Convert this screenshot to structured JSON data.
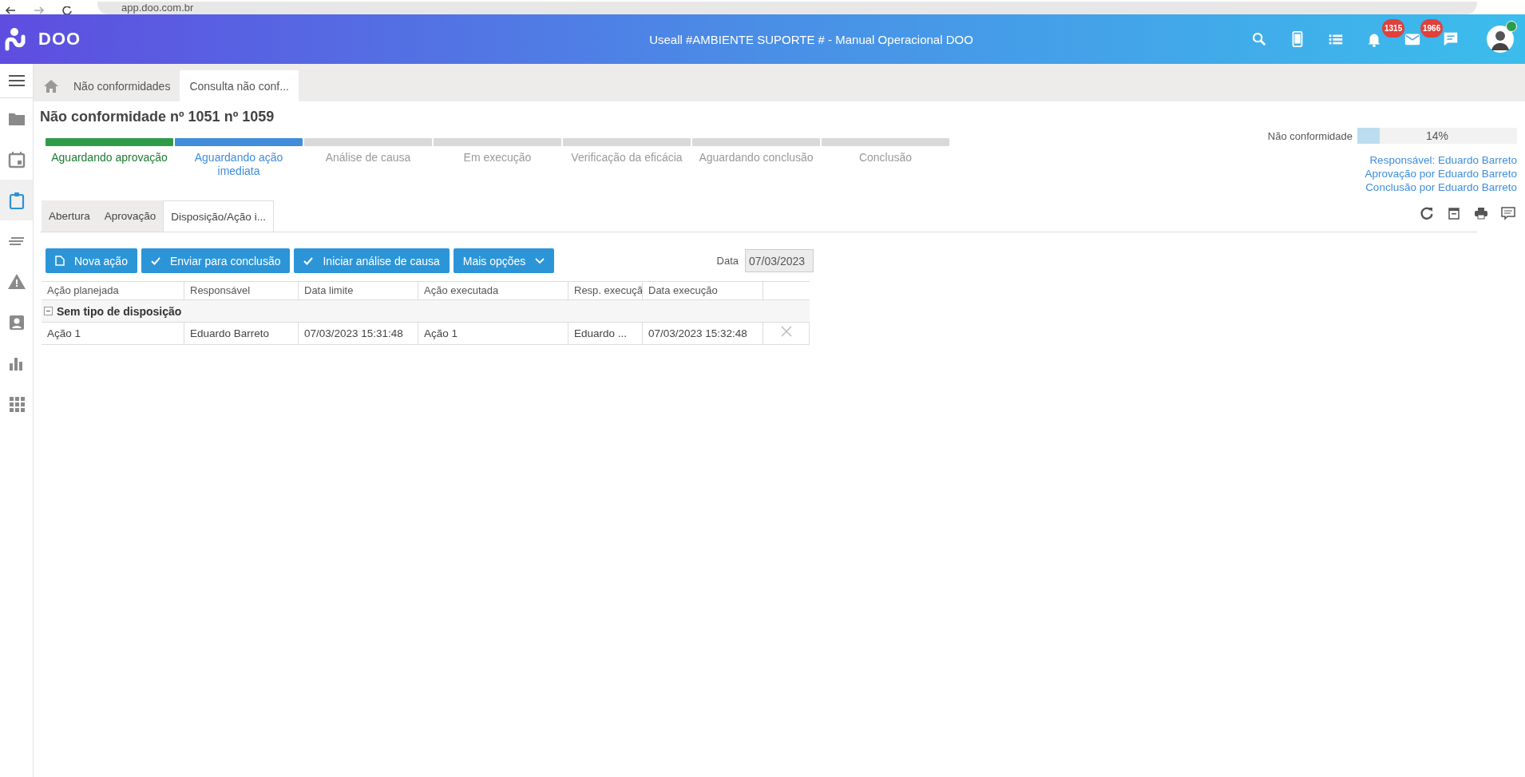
{
  "browser": {
    "url": "app.doo.com.br"
  },
  "header": {
    "brand": "DOO",
    "title": "Useall #AMBIENTE SUPORTE # - Manual Operacional DOO",
    "icons": [
      {
        "kind": "search"
      },
      {
        "kind": "phone"
      },
      {
        "kind": "list"
      },
      {
        "kind": "bell",
        "badge": "1315"
      },
      {
        "kind": "mail",
        "badge": "1966"
      },
      {
        "kind": "chat"
      }
    ],
    "user": {
      "online": true
    }
  },
  "sidebar": {
    "items": [
      {
        "kind": "folder",
        "selected": false
      },
      {
        "kind": "calendar",
        "selected": false
      },
      {
        "kind": "clipboard",
        "selected": true
      },
      {
        "kind": "lines",
        "selected": false
      },
      {
        "kind": "warning",
        "selected": false
      },
      {
        "kind": "contact",
        "selected": false
      },
      {
        "kind": "chart",
        "selected": false
      },
      {
        "kind": "apps",
        "selected": false
      }
    ]
  },
  "tabs": [
    {
      "label": "Não conformidades",
      "selected": false
    },
    {
      "label": "Consulta não conf...",
      "selected": true
    }
  ],
  "page_title": "Não conformidade nº 1051 nº 1059",
  "steps": [
    {
      "label": "Aguardando aprovação",
      "completed": true,
      "selected": false
    },
    {
      "label": "Aguardando ação imediata",
      "completed": false,
      "selected": true
    },
    {
      "label": "Análise de causa",
      "completed": false,
      "selected": false
    },
    {
      "label": "Em execução",
      "completed": false,
      "selected": false
    },
    {
      "label": "Verificação da eficácia",
      "completed": false,
      "selected": false
    },
    {
      "label": "Aguardando conclusão",
      "completed": false,
      "selected": false
    },
    {
      "label": "Conclusão",
      "completed": false,
      "selected": false
    }
  ],
  "progress": {
    "label": "Não conformidade",
    "level": 0.14,
    "reading": "14%"
  },
  "info": [
    "Responsável: Eduardo Barreto",
    "Aprovação por Eduardo Barreto",
    "Conclusão por Eduardo Barreto"
  ],
  "tools": [
    {
      "kind": "refresh"
    },
    {
      "kind": "calendar"
    },
    {
      "kind": "print"
    },
    {
      "kind": "comment"
    }
  ],
  "subtabs": [
    {
      "label": "Abertura",
      "selected": false
    },
    {
      "label": "Aprovação",
      "selected": false
    },
    {
      "label": "Disposição/Ação i...",
      "selected": true
    }
  ],
  "buttons": [
    {
      "label": "Nova ação",
      "kind": "doc"
    },
    {
      "label": "Enviar para conclusão",
      "kind": "check"
    },
    {
      "label": "Iniciar análise de causa",
      "kind": "check"
    },
    {
      "label": "Mais opções",
      "kind": "dropdown"
    }
  ],
  "date_field": {
    "label": "Data",
    "value": "07/03/2023",
    "disabled": true
  },
  "table": {
    "columns": [
      "Ação planejada",
      "Responsável",
      "Data limite",
      "Ação executada",
      "Resp. execuçã",
      "Data execução"
    ],
    "groups": [
      {
        "label": "Sem tipo de disposição",
        "expanded": true,
        "rows": [
          {
            "cells": [
              "Ação 1",
              "Eduardo Barreto",
              "07/03/2023 15:31:48",
              "Ação 1",
              "Eduardo ...",
              "07/03/2023 15:32:48"
            ]
          }
        ]
      }
    ]
  }
}
